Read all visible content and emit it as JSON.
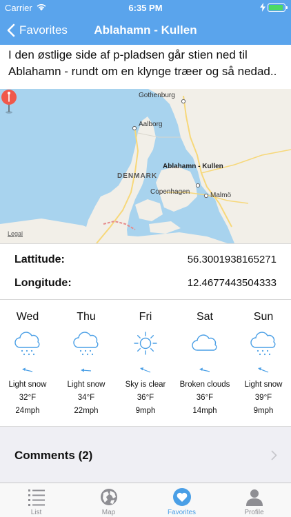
{
  "status_bar": {
    "carrier": "Carrier",
    "time": "6:35 PM"
  },
  "nav": {
    "back_label": "Favorites",
    "title": "Ablahamn - Kullen"
  },
  "description": "I den østlige side af p-pladsen går stien ned til Ablahamn - rundt om en klynge træer og så nedad..",
  "map": {
    "labels": {
      "gothenburg": "Gothenburg",
      "aalborg": "Aalborg",
      "pin": "Ablahamn - Kullen",
      "denmark": "DENMARK",
      "copenhagen": "Copenhagen",
      "malmo": "Malmö"
    },
    "legal": "Legal",
    "pin_color": "#f0584a"
  },
  "coordinates": {
    "latitude_label": "Lattitude:",
    "latitude_value": "56.3001938165271",
    "longitude_label": "Longitude:",
    "longitude_value": "12.4677443504333"
  },
  "forecast": [
    {
      "day": "Wed",
      "icon": "snow-cloud-icon",
      "condition": "Light snow",
      "temp": "32°F",
      "wind": "24mph"
    },
    {
      "day": "Thu",
      "icon": "snow-cloud-icon",
      "condition": "Light snow",
      "temp": "34°F",
      "wind": "22mph"
    },
    {
      "day": "Fri",
      "icon": "sun-icon",
      "condition": "Sky is clear",
      "temp": "36°F",
      "wind": "9mph"
    },
    {
      "day": "Sat",
      "icon": "cloud-icon",
      "condition": "Broken clouds",
      "temp": "36°F",
      "wind": "14mph"
    },
    {
      "day": "Sun",
      "icon": "snow-cloud-icon",
      "condition": "Light snow",
      "temp": "39°F",
      "wind": "9mph"
    }
  ],
  "comments": {
    "label": "Comments (2)"
  },
  "tabs": [
    {
      "label": "List",
      "icon": "list-icon"
    },
    {
      "label": "Map",
      "icon": "globe-icon"
    },
    {
      "label": "Favorites",
      "icon": "heart-icon",
      "active": true
    },
    {
      "label": "Profile",
      "icon": "person-icon"
    }
  ],
  "colors": {
    "accent": "#5aa4ec",
    "tab_active": "#4a9fe6",
    "weather_icon": "#4a9fe6"
  }
}
